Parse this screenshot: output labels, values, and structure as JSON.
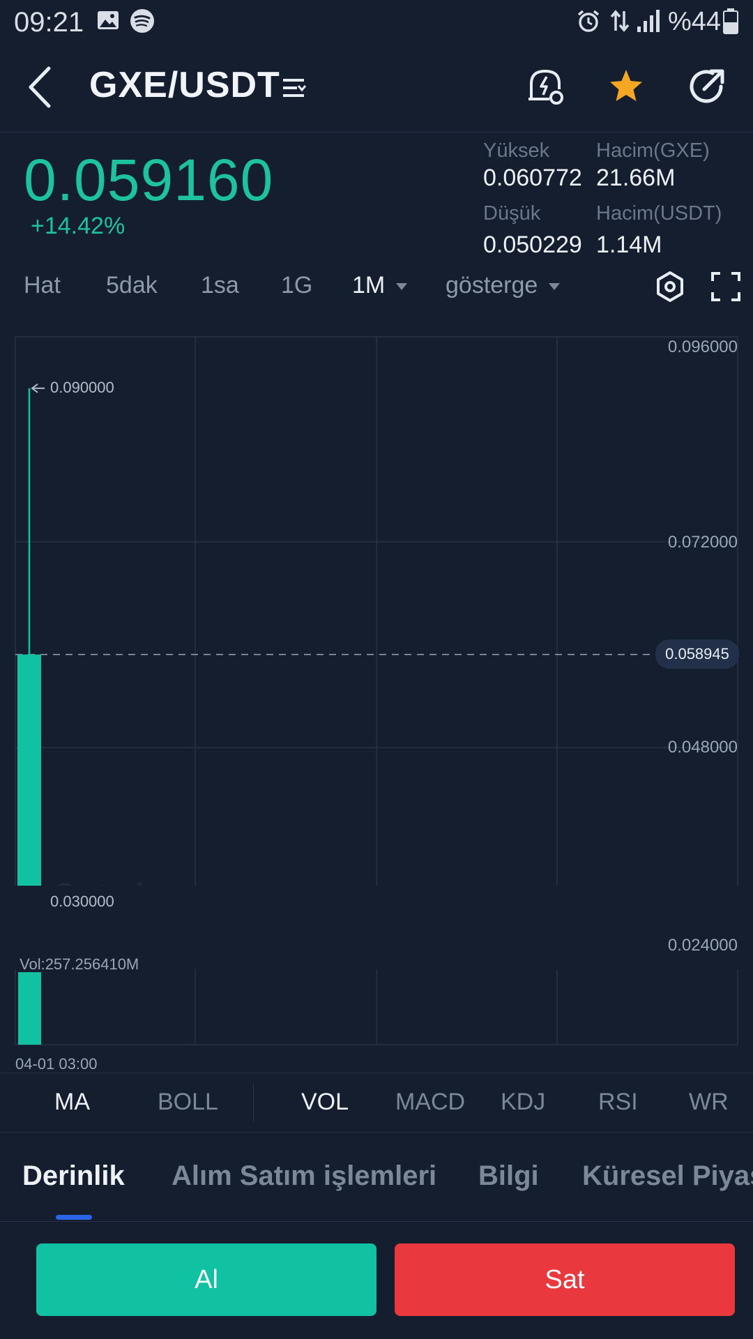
{
  "status_bar": {
    "time": "09:21",
    "battery": "%44"
  },
  "header": {
    "pair": "GXE/USDT"
  },
  "ticker": {
    "last_price": "0.059160",
    "change": "+14.42%",
    "high_label": "Yüksek",
    "high_value": "0.060772",
    "low_label": "Düşük",
    "low_value": "0.050229",
    "vol_base_label": "Hacim(GXE)",
    "vol_base_value": "21.66M",
    "vol_quote_label": "Hacim(USDT)",
    "vol_quote_value": "1.14M"
  },
  "timeframes": {
    "line": "Hat",
    "m5": "5dak",
    "h1": "1sa",
    "d1": "1G",
    "month": "1M",
    "indicator": "gösterge"
  },
  "chart": {
    "axis": [
      "0.096000",
      "0.072000",
      "0.048000",
      "0.024000"
    ],
    "current_price_tag": "0.058945",
    "high_note": "0.090000",
    "low_note": "0.030000",
    "vol_label": "Vol:257.256410M",
    "date_label": "04-01 03:00"
  },
  "chart_data": {
    "type": "candlestick",
    "ylim": [
      0.024,
      0.096
    ],
    "candles": [
      {
        "time": "04-01 03:00",
        "open": 0.03,
        "high": 0.09,
        "low": 0.03,
        "close": 0.058945
      }
    ],
    "volume": [
      257.25641
    ],
    "current_price": 0.058945,
    "grid": true
  },
  "indicators": {
    "ma": "MA",
    "boll": "BOLL",
    "vol": "VOL",
    "macd": "MACD",
    "kdj": "KDJ",
    "rsi": "RSI",
    "wr": "WR"
  },
  "tabs": {
    "depth": "Derinlik",
    "trades": "Alım Satım işlemleri",
    "info": "Bilgi",
    "global": "Küresel Piyasa"
  },
  "actions": {
    "buy": "Al",
    "sell": "Sat"
  },
  "colors": {
    "up": "#10c2a1",
    "down": "#e9393f",
    "accent": "#2c64e8",
    "star": "#f5a623"
  }
}
